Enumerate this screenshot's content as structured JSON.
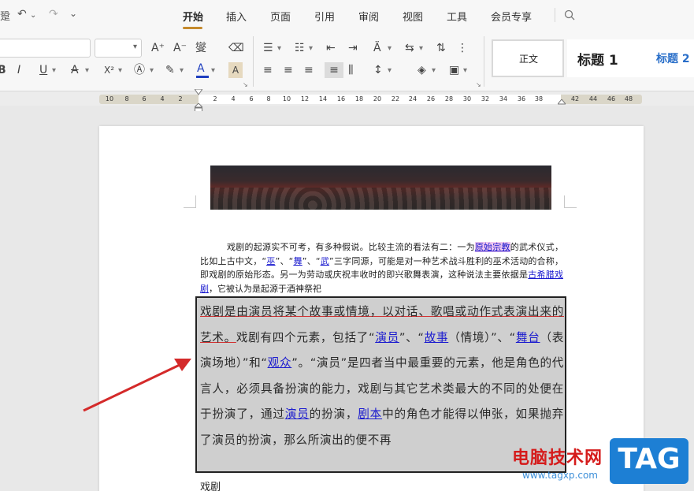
{
  "quick_access": {
    "undo": "↶",
    "redo": "↷",
    "more": "⌄",
    "left_glyph": "跫"
  },
  "menu": {
    "items": [
      "开始",
      "插入",
      "页面",
      "引用",
      "审阅",
      "视图",
      "工具",
      "会员专享"
    ],
    "active": "开始"
  },
  "ribbon": {
    "styles": {
      "normal": "正文",
      "heading1": "标题 1",
      "heading2": "标题 2"
    },
    "font_buttons": {
      "grow": "A⁺",
      "shrink": "A⁻",
      "bold": "B",
      "underline": "U",
      "strike": "A",
      "superscript": "X²",
      "font_color": "A",
      "char_shade": "A"
    },
    "colors": {
      "font_color_bar": "#1f3fbf",
      "heading2_color": "#2a6fc9"
    }
  },
  "ruler": {
    "left_numbers": [
      "10",
      "8",
      "6",
      "4",
      "2"
    ],
    "mid_numbers": [
      "2",
      "4",
      "6",
      "8",
      "10",
      "12",
      "14",
      "16",
      "18",
      "20",
      "22",
      "24",
      "26",
      "28",
      "30",
      "32",
      "34",
      "36",
      "38"
    ],
    "right_numbers": [
      "42",
      "44",
      "46",
      "48"
    ]
  },
  "document": {
    "para1": {
      "part1": "戏剧的起源实不可考，有多种假说。比较主流的看法有二：一为",
      "link1": "原始宗教",
      "part2": "的武术仪式，比如上古中文，“",
      "link2": "巫",
      "part3": "”、“",
      "link3": "舞",
      "part4": "”、“",
      "link4": "武",
      "part5": "”三字同源，可能是对一种艺术战斗胜利的巫术活动的合称，即戏剧的原始形态。另一为劳动或庆祝丰收时的即兴歌舞表演，这种说法主要依据是",
      "link5": "古希腊戏剧",
      "part6": "，它被认为是起源于酒神祭祀"
    },
    "para2": {
      "underlined": "戏剧是由演员将某个故事或情境，以对话、歌唱或动作式表演出来的艺术。",
      "part1": "戏剧有四个元素，包括了“",
      "link1": "演员",
      "part2": "”、“",
      "link2": "故事",
      "part3": "（情境）”、“",
      "link3": "舞台",
      "part4": "（表演场地）”和“",
      "link4": "观众",
      "part5": "”。“演员”是四者当中最重要的元素，他是角色的代言人，必须具备扮演的能力，戏剧与其它艺术类最大的不同的处便在于扮演了，通过",
      "link5": "演员",
      "part6": "的扮演，",
      "link6": "剧本",
      "part7": "中的角色才能得以伸张，如果抛弃了演员的扮演，那么所演出的便不再"
    },
    "para3": "戏剧"
  },
  "watermark": {
    "text": "电脑技术网",
    "url": "www.tagxp.com",
    "logo": "TAG"
  }
}
